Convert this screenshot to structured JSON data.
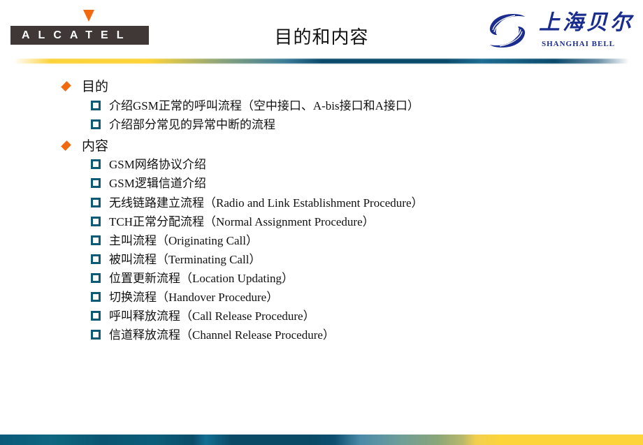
{
  "header": {
    "left_logo": {
      "text": "ALCATEL",
      "accent_color": "#f26a10",
      "bar_color": "#3f3837"
    },
    "title": "目的和内容",
    "right_logo": {
      "chinese": "上海贝尔",
      "english": "SHANGHAI BELL",
      "brand_color": "#1a2d8f"
    }
  },
  "sections": [
    {
      "heading": "目的",
      "icon": "diamond-icon",
      "items": [
        "介绍GSM正常的呼叫流程（空中接口、A-bis接口和A接口）",
        "介绍部分常见的异常中断的流程"
      ]
    },
    {
      "heading": "内容",
      "icon": "diamond-icon",
      "items": [
        "GSM网络协议介绍",
        "GSM逻辑信道介绍",
        "无线链路建立流程（Radio and Link Establishment Procedure）",
        "TCH正常分配流程（Normal Assignment Procedure）",
        "主叫流程（Originating Call）",
        "被叫流程（Terminating Call）",
        "位置更新流程（Location Updating）",
        "切换流程（Handover Procedure）",
        "呼叫释放流程（Call Release Procedure）",
        "信道释放流程（Channel Release Procedure）"
      ]
    }
  ],
  "colors": {
    "bullet_diamond": "#f26a10",
    "bullet_square": "#0c5a73",
    "stripe_yellow": "#fdd43a",
    "stripe_teal": "#0a4a6b"
  }
}
